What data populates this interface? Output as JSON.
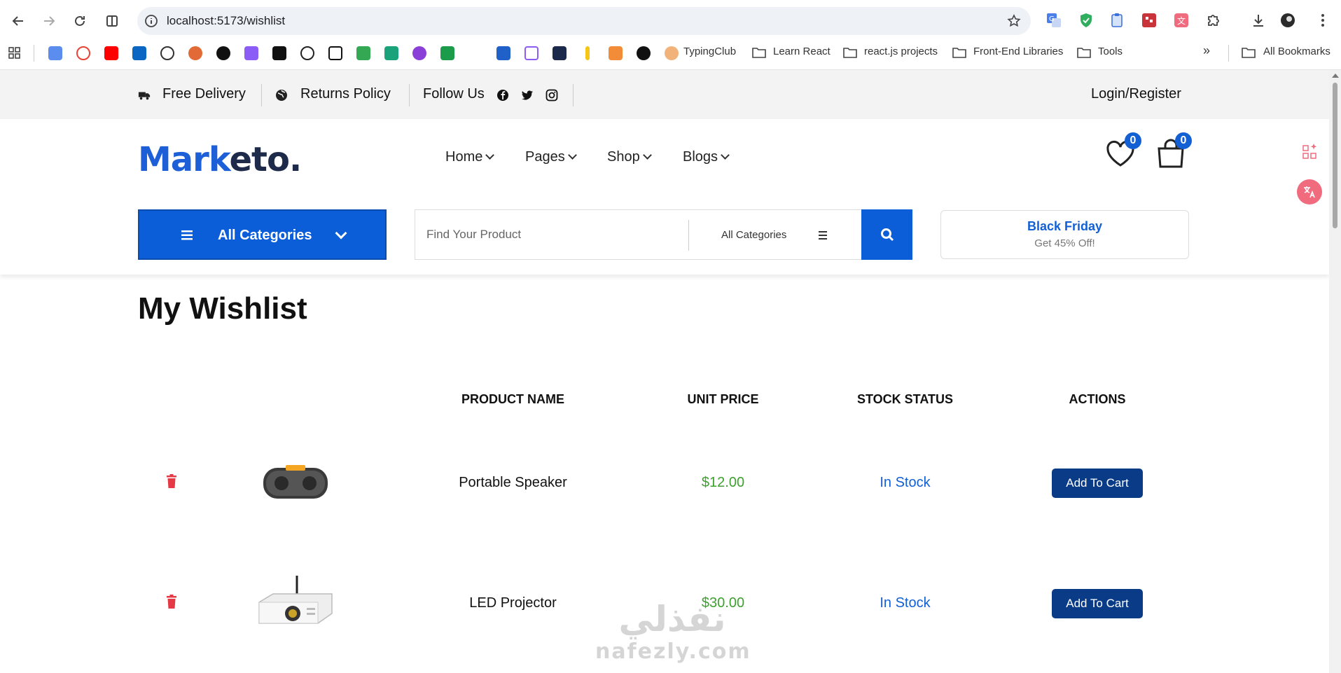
{
  "browser": {
    "url": "localhost:5173/wishlist",
    "bookmarks": {
      "typingclub": "TypingClub",
      "learn_react": "Learn React",
      "react_projects": "react.js projects",
      "frontend_libs": "Front-End Libraries",
      "tools": "Tools",
      "more": "»",
      "all_bookmarks": "All Bookmarks"
    }
  },
  "topbar": {
    "free_delivery": "Free Delivery",
    "returns_policy": "Returns Policy",
    "follow_us": "Follow Us",
    "login": "Login/Register"
  },
  "header": {
    "logo_part1": "Mark",
    "logo_part2": "eto.",
    "nav": [
      "Home",
      "Pages",
      "Shop",
      "Blogs"
    ],
    "wishlist_count": "0",
    "cart_count": "0",
    "all_categories": "All Categories",
    "search_placeholder": "Find Your Product",
    "search_category": "All Categories",
    "promo_title": "Black Friday",
    "promo_sub": "Get 45% Off!"
  },
  "wishlist": {
    "title": "My Wishlist",
    "columns": {
      "product_name": "PRODUCT NAME",
      "unit_price": "UNIT PRICE",
      "stock_status": "STOCK STATUS",
      "actions": "ACTIONS"
    },
    "items": [
      {
        "name": "Portable Speaker",
        "price": "$12.00",
        "stock": "In Stock",
        "action": "Add To Cart"
      },
      {
        "name": "LED Projector",
        "price": "$30.00",
        "stock": "In Stock",
        "action": "Add To Cart"
      }
    ]
  },
  "watermark": {
    "arabic": "نفذلي",
    "latin": "nafezly.com"
  },
  "colors": {
    "primary": "#0b5ed7",
    "button_dark": "#0a3b86",
    "price": "#3ea12f",
    "trash": "#e53945"
  }
}
